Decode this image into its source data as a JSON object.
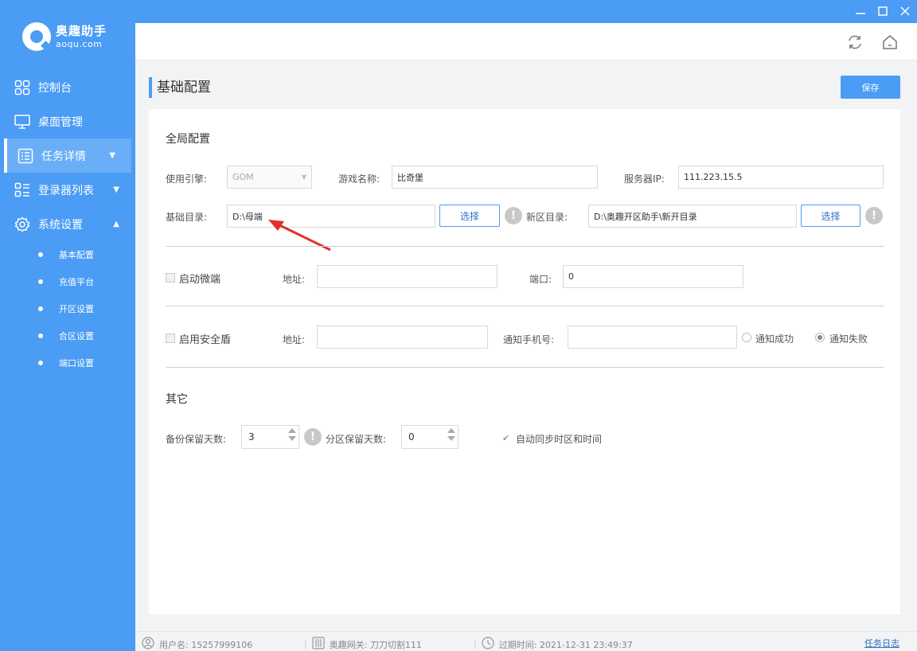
{
  "app": {
    "logo_cn": "奥趣助手",
    "logo_en": "aoqu.com",
    "accent": "#4a9cf5"
  },
  "sidebar": {
    "items": [
      {
        "label": "控制台",
        "icon": "dashboard-icon"
      },
      {
        "label": "桌面管理",
        "icon": "monitor-icon"
      },
      {
        "label": "任务详情",
        "icon": "task-list-icon",
        "active": true,
        "caret": "down"
      },
      {
        "label": "登录器列表",
        "icon": "list-icon",
        "caret": "down"
      },
      {
        "label": "系统设置",
        "icon": "gear-icon",
        "caret": "up"
      }
    ],
    "subitems": [
      "基本配置",
      "充值平台",
      "开区设置",
      "合区设置",
      "端口设置"
    ]
  },
  "page": {
    "title": "基础配置",
    "save_label": "保存"
  },
  "global": {
    "section_title": "全局配置",
    "engine_label": "使用引擎:",
    "engine_value": "GOM",
    "game_name_label": "游戏名称:",
    "game_name_value": "比奇堡",
    "server_ip_label": "服务器IP:",
    "server_ip_value": "111.223.15.5",
    "base_dir_label": "基础目录:",
    "base_dir_value": "D:\\母端",
    "choose_label": "选择",
    "new_dir_label": "新区目录:",
    "new_dir_value": "D:\\奥趣开区助手\\新开目录",
    "warn_glyph": "!"
  },
  "micro": {
    "label": "启动微端",
    "address_label": "地址:",
    "address_value": "",
    "port_label": "端口:",
    "port_value": "0"
  },
  "shield": {
    "label": "启用安全盾",
    "address_label": "地址:",
    "address_value": "",
    "phone_label": "通知手机号:",
    "phone_value": "",
    "notify_success": "通知成功",
    "notify_fail": "通知失败",
    "selected": "notify_fail"
  },
  "other": {
    "section_title": "其它",
    "backup_days_label": "备份保留天数:",
    "backup_days_value": "3",
    "partition_days_label": "分区保留天数:",
    "partition_days_value": "0",
    "auto_sync_label": "自动同步时区和时间",
    "auto_sync_checked": true
  },
  "status": {
    "username": "用户名: 15257999106",
    "gateway": "奥趣网关: 刀刀切割111",
    "expiry": "过期时间: 2021-12-31 23:49:37",
    "task_log": "任务日志"
  }
}
